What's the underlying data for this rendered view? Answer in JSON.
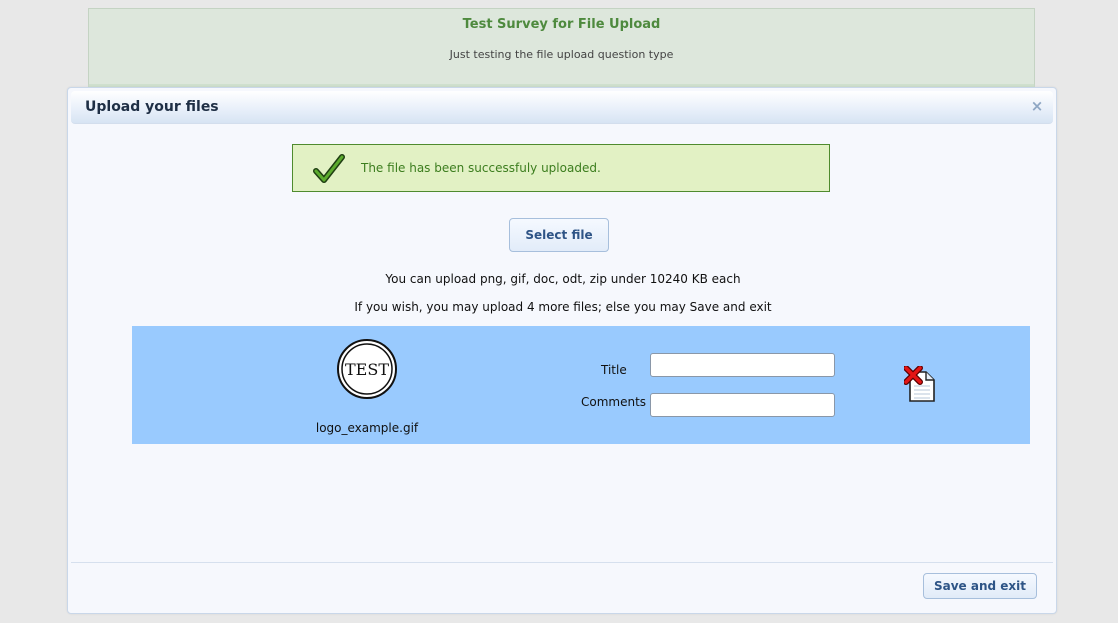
{
  "survey": {
    "title": "Test Survey for File Upload",
    "description": "Just testing the file upload question type"
  },
  "dialog": {
    "title": "Upload your files",
    "close_label": "×",
    "close_icon": "close-icon"
  },
  "success": {
    "message": "The file has been successfuly uploaded.",
    "icon": "checkmark-icon"
  },
  "select_file_label": "Select file",
  "info": {
    "allowed_types": "You can upload png, gif, doc, odt, zip under 10240 KB each",
    "remaining": "If you wish, you may upload 4 more files; else you may Save and exit"
  },
  "file_row": {
    "thumbnail_text": "TEST",
    "file_name": "logo_example.gif",
    "title_label": "Title",
    "comments_label": "Comments",
    "title_value": "",
    "comments_value": "",
    "delete_icon": "delete-file-icon"
  },
  "save_exit_label": "Save and exit",
  "colors": {
    "success_bg": "#e2f1c4",
    "success_border": "#4f8b2e",
    "file_row_bg": "#99cafe",
    "survey_title": "#4e8a3e",
    "button_text": "#2e5486"
  }
}
